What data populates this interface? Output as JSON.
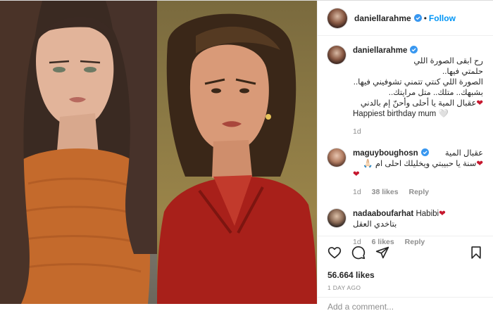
{
  "post": {
    "author": "daniellarahme",
    "follow_label": "Follow",
    "separator": "•"
  },
  "caption": {
    "username": "daniellarahme",
    "lines": [
      "رح ابقى الصورة اللي",
      "حلمتي فيها..",
      "الصورة اللي كنتي تتمني تشوفيني فيها..",
      "بشبهك.. متلك.. متل مرايتك..",
      "عقبال المية يا أحلى وأحنّ إم بالدني",
      "Happiest birthday mum 🤍"
    ],
    "age": "1d"
  },
  "comments": [
    {
      "username": "maguyboughosn",
      "text_lines": [
        "عقبال المية",
        "سنة يا حبيبتي ويخليلك احلى ام 🙏🏻"
      ],
      "age": "1d",
      "likes": "38 likes",
      "reply_label": "Reply"
    },
    {
      "username": "nadaaboufarhat",
      "text_lines": [
        "Habibi",
        "بتاخدي العقل"
      ],
      "age": "1d",
      "likes": "6 likes",
      "reply_label": "Reply"
    }
  ],
  "engagement": {
    "likes_count": "56.664 likes",
    "posted": "1 DAY AGO",
    "add_comment_placeholder": "Add a comment..."
  },
  "icons": {
    "like": "heart-outline-icon",
    "comment": "speech-bubble-icon",
    "share": "paper-plane-icon",
    "save": "bookmark-icon",
    "verified": "verified-badge-icon"
  },
  "colors": {
    "accent": "#0095f6",
    "verified": "#3897f0",
    "heart": "#c6172e",
    "muted": "#8e8e8e"
  }
}
